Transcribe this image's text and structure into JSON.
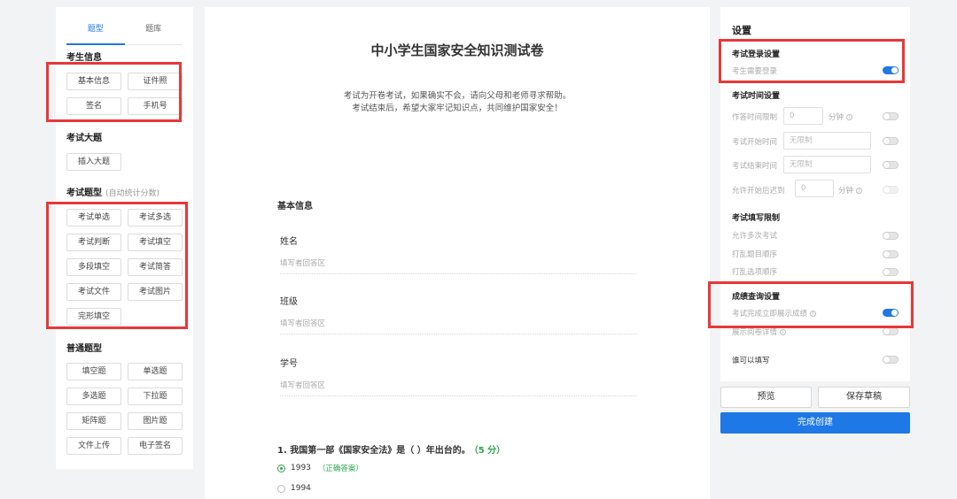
{
  "left": {
    "tabs": [
      "题型",
      "题库"
    ],
    "sections": {
      "candidate_info": "考生信息",
      "exam_section": "考试大题",
      "exam_types": "考试题型",
      "exam_types_sub": "(自动统计分数)",
      "normal_types": "普通题型"
    },
    "candidate_buttons": [
      "基本信息",
      "证件照",
      "签名",
      "手机号"
    ],
    "insert_section": "插入大题",
    "exam_buttons": [
      "考试单选",
      "考试多选",
      "考试判断",
      "考试填空",
      "多段填空",
      "考试简答",
      "考试文件",
      "考试图片",
      "完形填空"
    ],
    "normal_buttons": [
      "填空题",
      "单选题",
      "多选题",
      "下拉题",
      "矩阵题",
      "图片题",
      "文件上传",
      "电子签名"
    ]
  },
  "center": {
    "title": "中小学生国家安全知识测试卷",
    "desc_line1": "考试为开卷考试，如果确实不会，请向父母和老师寻求帮助。",
    "desc_line2": "考试结束后，希望大家牢记知识点，共同维护国家安全！",
    "section": "基本信息",
    "fields": [
      {
        "label": "姓名",
        "placeholder": "填写者回答区"
      },
      {
        "label": "班级",
        "placeholder": "填写者回答区"
      },
      {
        "label": "学号",
        "placeholder": "填写者回答区"
      }
    ],
    "question": {
      "text": "1. 我国第一部《国家安全法》是（ ）年出台的。",
      "score": "（5 分）",
      "options": [
        {
          "label": "1993",
          "note": "（正确答案）",
          "selected": true
        },
        {
          "label": "1994",
          "note": "",
          "selected": false
        }
      ]
    }
  },
  "right": {
    "title": "设置",
    "login_section": "考试登录设置",
    "login_row": "考生需要登录",
    "time_section": "考试时间设置",
    "time_limit": "作答时间限制",
    "time_limit_value": "0",
    "minute_unit": "分钟",
    "start_time": "考试开始时间",
    "end_time": "考试结束时间",
    "no_limit": "无限制",
    "late_limit": "允许开始后迟到",
    "late_value": "0",
    "fill_section": "考试填写限制",
    "multi_exam": "允许多次考试",
    "shuffle_questions": "打乱题目顺序",
    "shuffle_options": "打乱选项顺序",
    "score_section": "成绩查询设置",
    "show_score": "考试完成立即展示成绩",
    "show_detail": "展示阅卷详情",
    "who_can_fill": "谁可以填写",
    "preview": "预览",
    "save_draft": "保存草稿",
    "finish": "完成创建"
  },
  "colors": {
    "accent": "#1e78e6",
    "highlight": "#e83838",
    "correct": "#2ea44f"
  }
}
